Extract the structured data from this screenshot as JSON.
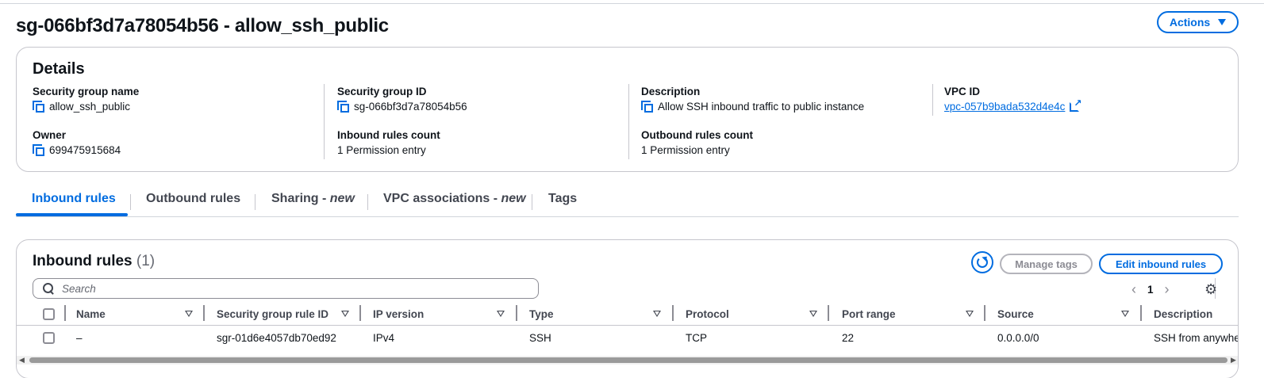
{
  "page": {
    "title": "sg-066bf3d7a78054b56 - allow_ssh_public",
    "actions_label": "Actions"
  },
  "details": {
    "heading": "Details",
    "fields": [
      {
        "label": "Security group name",
        "value": "allow_ssh_public",
        "copy": true
      },
      {
        "label": "Security group ID",
        "value": "sg-066bf3d7a78054b56",
        "copy": true
      },
      {
        "label": "Description",
        "value": "Allow SSH inbound traffic to public instance",
        "copy": true
      },
      {
        "label": "VPC ID",
        "value": "vpc-057b9bada532d4e4c",
        "link": true
      },
      {
        "label": "Owner",
        "value": "699475915684",
        "copy": true
      },
      {
        "label": "Inbound rules count",
        "value": "1 Permission entry"
      },
      {
        "label": "Outbound rules count",
        "value": "1 Permission entry"
      }
    ]
  },
  "tabs": [
    {
      "label": "Inbound rules",
      "suffix": "",
      "active": true
    },
    {
      "label": "Outbound rules",
      "suffix": ""
    },
    {
      "label": "Sharing - ",
      "suffix": "new"
    },
    {
      "label": "VPC associations - ",
      "suffix": "new"
    },
    {
      "label": "Tags",
      "suffix": ""
    }
  ],
  "rules": {
    "heading": "Inbound rules",
    "count": "(1)",
    "manage_tags_label": "Manage tags",
    "edit_label": "Edit inbound rules",
    "search_placeholder": "Search",
    "page_number": "1",
    "columns": [
      "Name",
      "Security group rule ID",
      "IP version",
      "Type",
      "Protocol",
      "Port range",
      "Source",
      "Description"
    ],
    "rows": [
      [
        "–",
        "sgr-01d6e4057db70ed92",
        "IPv4",
        "SSH",
        "TCP",
        "22",
        "0.0.0.0/0",
        "SSH from anywhere"
      ]
    ]
  },
  "colors": {
    "accent": "#006ce0",
    "text": "#0f141a",
    "border": "#c6c6cd"
  }
}
